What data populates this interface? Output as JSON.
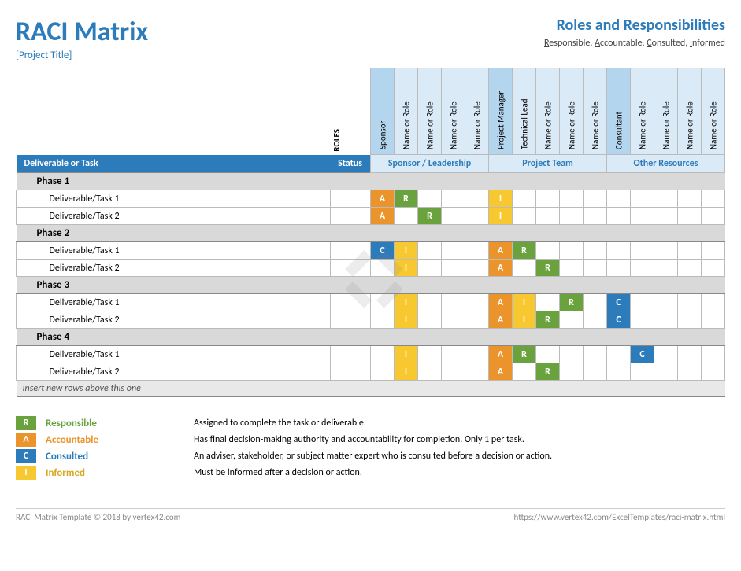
{
  "header": {
    "title": "RACI Matrix",
    "subtitle": "[Project Title]",
    "roles_title": "Roles and Responsibilities",
    "roles_sub_r": "R",
    "roles_sub_responsible": "esponsible, ",
    "roles_sub_a": "A",
    "roles_sub_accountable": "ccountable, ",
    "roles_sub_c": "C",
    "roles_sub_consulted": "onsulted, ",
    "roles_sub_i": "I",
    "roles_sub_informed": "nformed"
  },
  "labels": {
    "roles": "ROLES",
    "deliverable": "Deliverable or Task",
    "status": "Status",
    "insert_note": "Insert new rows above this one"
  },
  "role_groups": [
    {
      "name": "Sponsor / Leadership",
      "roles": [
        "Sponsor",
        "Name or Role",
        "Name or Role",
        "Name or Role",
        "Name or Role"
      ]
    },
    {
      "name": "Project Team",
      "roles": [
        "Project Manager",
        "Technical Lead",
        "Name or Role",
        "Name or Role",
        "Name or Role"
      ]
    },
    {
      "name": "Other Resources",
      "roles": [
        "Consultant",
        "Name or Role",
        "Name or Role",
        "Name or Role",
        "Name or Role"
      ]
    }
  ],
  "phases": [
    {
      "name": "Phase 1",
      "tasks": [
        {
          "name": "Deliverable/Task 1",
          "cells": [
            "A",
            "R",
            "",
            "",
            "",
            "I",
            "",
            "",
            "",
            "",
            "",
            "",
            "",
            "",
            ""
          ]
        },
        {
          "name": "Deliverable/Task 2",
          "cells": [
            "A",
            "",
            "R",
            "",
            "",
            "I",
            "",
            "",
            "",
            "",
            "",
            "",
            "",
            "",
            ""
          ]
        }
      ]
    },
    {
      "name": "Phase 2",
      "tasks": [
        {
          "name": "Deliverable/Task 1",
          "cells": [
            "C",
            "I",
            "",
            "",
            "",
            "A",
            "R",
            "",
            "",
            "",
            "",
            "",
            "",
            "",
            ""
          ]
        },
        {
          "name": "Deliverable/Task 2",
          "cells": [
            "",
            "I",
            "",
            "",
            "",
            "A",
            "",
            "R",
            "",
            "",
            "",
            "",
            "",
            "",
            ""
          ]
        }
      ]
    },
    {
      "name": "Phase 3",
      "tasks": [
        {
          "name": "Deliverable/Task 1",
          "cells": [
            "",
            "I",
            "",
            "",
            "",
            "A",
            "I",
            "",
            "R",
            "",
            "C",
            "",
            "",
            "",
            ""
          ]
        },
        {
          "name": "Deliverable/Task 2",
          "cells": [
            "",
            "I",
            "",
            "",
            "",
            "A",
            "I",
            "R",
            "",
            "",
            "C",
            "",
            "",
            "",
            ""
          ]
        }
      ]
    },
    {
      "name": "Phase 4",
      "tasks": [
        {
          "name": "Deliverable/Task 1",
          "cells": [
            "",
            "I",
            "",
            "",
            "",
            "A",
            "R",
            "",
            "",
            "",
            "",
            "C",
            "",
            "",
            ""
          ]
        },
        {
          "name": "Deliverable/Task 2",
          "cells": [
            "",
            "I",
            "",
            "",
            "",
            "A",
            "",
            "R",
            "",
            "",
            "",
            "",
            "",
            "",
            ""
          ]
        }
      ]
    }
  ],
  "legend": [
    {
      "code": "R",
      "label": "Responsible",
      "desc": "Assigned to complete the task or deliverable."
    },
    {
      "code": "A",
      "label": "Accountable",
      "desc": "Has final decision-making authority and accountability for completion. Only 1 per task."
    },
    {
      "code": "C",
      "label": "Consulted",
      "desc": "An adviser, stakeholder, or subject matter expert who is consulted before a decision or action."
    },
    {
      "code": "I",
      "label": "Informed",
      "desc": "Must be informed after a decision or action."
    }
  ],
  "footer": {
    "left": "RACI Matrix Template © 2018 by vertex42.com",
    "right": "https://www.vertex42.com/ExcelTemplates/raci-matrix.html"
  }
}
